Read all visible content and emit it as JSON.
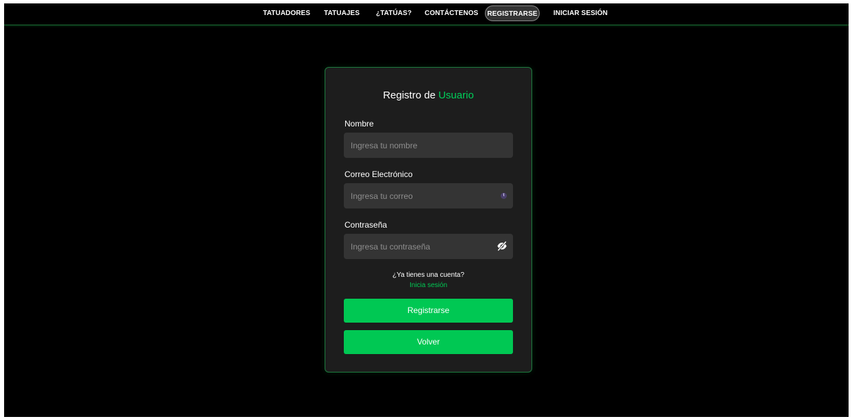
{
  "nav": {
    "items": [
      {
        "label": "TATUADORES"
      },
      {
        "label": "TATUAJES"
      },
      {
        "label": "¿TATÚAS?"
      },
      {
        "label": "CONTÁCTENOS"
      },
      {
        "label": "REGISTRARSE",
        "active": true
      },
      {
        "label": "INICIAR SESIÓN"
      }
    ]
  },
  "form": {
    "title_prefix": "Registro de",
    "title_accent": "Usuario",
    "name_label": "Nombre",
    "name_placeholder": "Ingresa tu nombre",
    "name_value": "",
    "email_label": "Correo Electrónico",
    "email_placeholder": "Ingresa tu correo",
    "email_value": "",
    "email_badge": "t",
    "password_label": "Contraseña",
    "password_placeholder": "Ingresa tu contraseña",
    "password_value": "",
    "password_toggle_icon": "eye-slash-icon",
    "have_account_text": "¿Ya tienes una cuenta?",
    "login_link_text": "Inicia sesión",
    "register_button": "Registrarse",
    "back_button": "Volver"
  },
  "colors": {
    "background": "#000000",
    "card": "#1d1d1d",
    "accent": "#00c853",
    "input": "#343434",
    "card_border": "#1e7a3e"
  }
}
